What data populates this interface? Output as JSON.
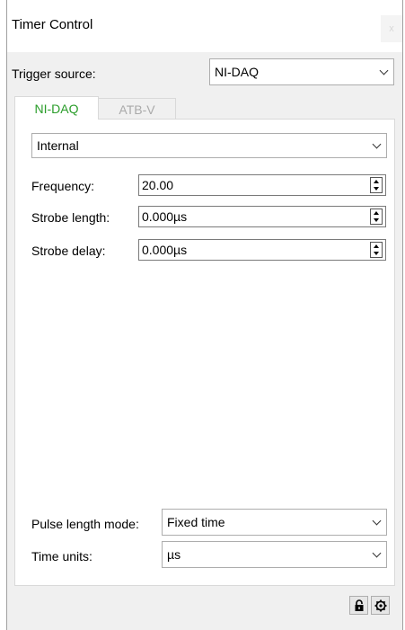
{
  "window": {
    "title": "Timer Control",
    "close_label": "x"
  },
  "trigger": {
    "label": "Trigger source:",
    "value": "NI-DAQ"
  },
  "tabs": [
    {
      "label": "NI-DAQ",
      "active": true
    },
    {
      "label": "ATB-V",
      "active": false
    }
  ],
  "panel": {
    "mode_value": "Internal",
    "frequency": {
      "label": "Frequency:",
      "value": "20.00"
    },
    "strobe_length": {
      "label": "Strobe length:",
      "value": "0.000µs"
    },
    "strobe_delay": {
      "label": "Strobe delay:",
      "value": "0.000µs"
    },
    "pulse_length_mode": {
      "label": "Pulse length mode:",
      "value": "Fixed time"
    },
    "time_units": {
      "label": "Time units:",
      "value": "µs"
    }
  },
  "footer": {
    "icons": [
      "lock-icon",
      "gear-icon"
    ]
  },
  "colors": {
    "active_tab_text": "#2a9d2a",
    "inactive_tab_text": "#aaaaaa"
  }
}
